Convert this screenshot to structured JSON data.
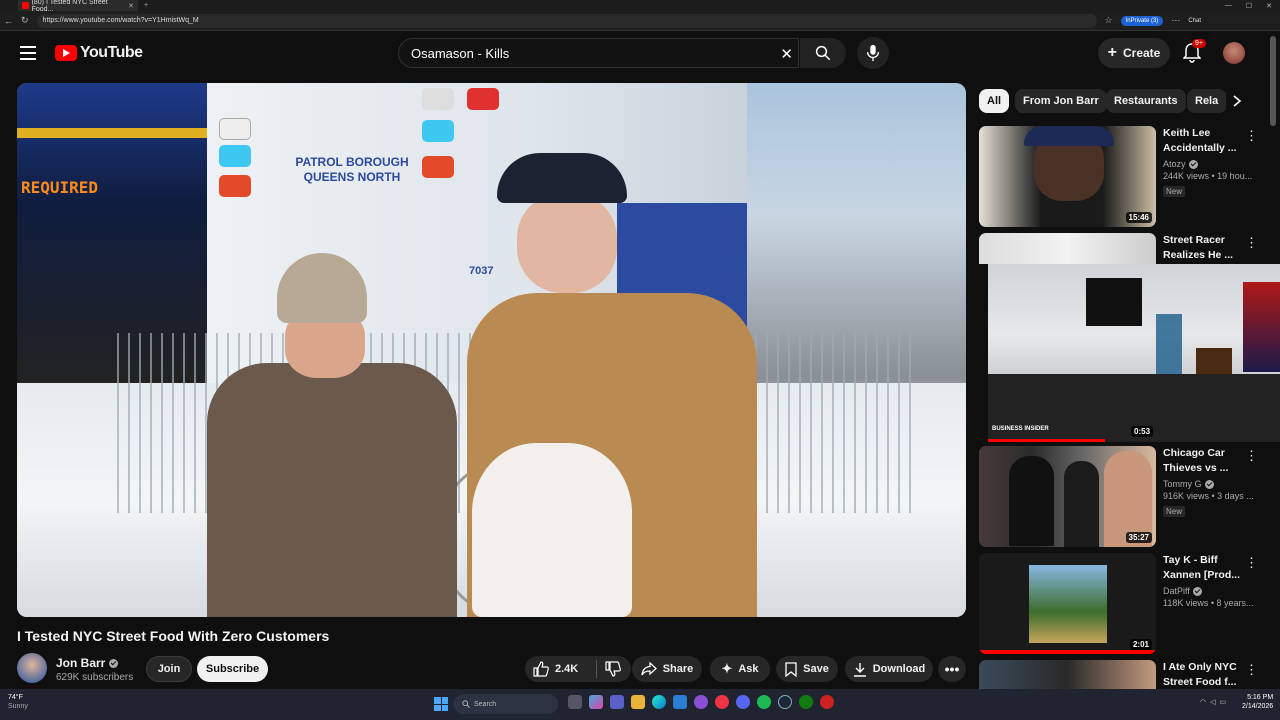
{
  "browser": {
    "tab_title": "(80) I Tested NYC Street Food...",
    "url": "https://www.youtube.com/watch?v=Y1HmistWq_M",
    "inprivate_label": "InPrivate (3)",
    "chat_label": "Chat"
  },
  "youtube": {
    "logo_text": "YouTube",
    "search_value": "Osamason - Kills",
    "create_label": "Create",
    "notif_count": "9+"
  },
  "video": {
    "title": "I Tested NYC Street Food With Zero Customers",
    "channel": "Jon Barr",
    "subscribers": "629K subscribers",
    "join_label": "Join",
    "subscribe_label": "Subscribe",
    "like_count": "2.4K",
    "share_label": "Share",
    "ask_label": "Ask",
    "save_label": "Save",
    "download_label": "Download",
    "frame_text": {
      "bus_sign": "REQUIRED",
      "truck_text": "PATROL BOROUGH QUEENS NORTH",
      "truck_number": "7037"
    }
  },
  "chips": [
    "All",
    "From Jon Barr",
    "Restaurants",
    "Rela"
  ],
  "recommendations": [
    {
      "title": "Keith Lee Accidentally ...",
      "channel": "Atozy",
      "verified": true,
      "views": "244K views • 19 hou...",
      "badge": "New",
      "duration": "15:46"
    },
    {
      "title": "Street Racer Realizes He ...",
      "channel": "",
      "verified": false,
      "views": "",
      "badge": "",
      "duration": "0:53"
    },
    {
      "title": "Chicago Car Thieves vs ...",
      "channel": "Tommy G",
      "verified": true,
      "views": "916K views • 3 days ...",
      "badge": "New",
      "duration": "35:27"
    },
    {
      "title": "Tay K - Biff Xannen [Prod...",
      "channel": "DatPiff",
      "verified": true,
      "views": "118K views • 8 years...",
      "badge": "",
      "duration": "2:01"
    },
    {
      "title": "I Ate Only NYC Street Food f...",
      "channel": "",
      "verified": false,
      "views": "",
      "badge": "",
      "duration": ""
    }
  ],
  "preview": {
    "brand_text": "BUSINESS INSIDER",
    "progress": 0.4
  },
  "taskbar": {
    "temp": "74°F",
    "condition": "Sunny",
    "search_placeholder": "Search",
    "time": "5:16 PM",
    "date": "2/14/2026"
  },
  "colors": {
    "background": "#0f0f0f",
    "accent_red": "#ff0000",
    "chip_bg": "#272727",
    "subscribe_bg": "#f1f1f1"
  }
}
